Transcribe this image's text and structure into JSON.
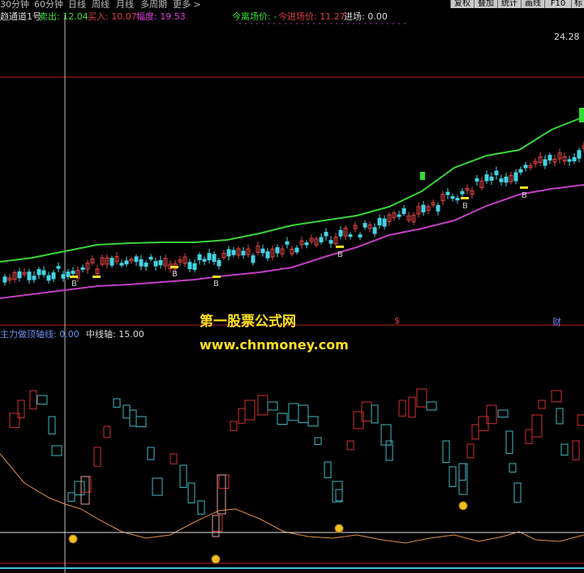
{
  "toolbar": {
    "periods": [
      "30分钟",
      "60分钟",
      "日线",
      "周线",
      "月线",
      "多周期",
      "更多 >"
    ],
    "right_buttons": [
      "复权",
      "叠加",
      "统计",
      "画线",
      "F10",
      "标"
    ]
  },
  "main_legend": {
    "indicator_name": "趋通道1号",
    "sell_text": "卖出: 12.04",
    "buy_text": "买入: 10.07",
    "amplitude_text": "幅度: 19.53",
    "exit_text": "今离场价: -",
    "entry_text": "今进场价: 11.27",
    "enter_text": "进场: 0.00"
  },
  "price_label": "24.28",
  "markers": {
    "buy": "B",
    "s": "$",
    "cai": "财"
  },
  "sub_legend": {
    "axis_text": "主力做顶轴线: 0.00",
    "mid_text": "中线轴: 15.00"
  },
  "watermark": {
    "title": "第一股票公式网",
    "url": "www.chnmoney.com"
  },
  "colors": {
    "upper_band": "#3ad43a",
    "lower_band": "#c23ec2",
    "up_candle": "#e04444",
    "down_candle": "#44d4e4",
    "sub_up": "#d03030",
    "sub_down": "#40b8c0",
    "buy_marker": "#f0e020",
    "watermark": "#ffe020"
  }
}
